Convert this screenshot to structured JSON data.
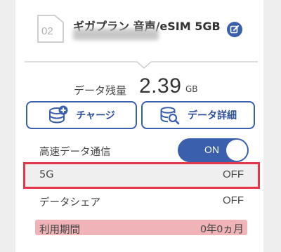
{
  "sim": {
    "slot": "02",
    "plan_name": "ギガプラン 音声/eSIM 5GB"
  },
  "data_remaining": {
    "label": "データ残量",
    "value": "2.39",
    "unit": "GB"
  },
  "buttons": {
    "charge": "チャージ",
    "detail": "データ詳細"
  },
  "settings": {
    "high_speed": {
      "label": "高速データ通信",
      "toggle": "ON"
    },
    "five_g": {
      "label": "5G",
      "value": "OFF"
    },
    "data_share": {
      "label": "データシェア",
      "value": "OFF"
    },
    "usage_period": {
      "label": "利用期間",
      "value": "0年0ヵ月"
    }
  },
  "colors": {
    "accent": "#3a5fad",
    "highlight_border": "#e5374a",
    "period_bg": "#efb3b8"
  },
  "icons": [
    "sim-card-icon",
    "edit-icon",
    "database-add-icon",
    "database-search-icon"
  ]
}
